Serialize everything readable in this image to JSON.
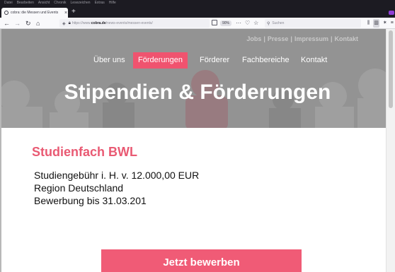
{
  "browser": {
    "menu": [
      "Datei",
      "Bearbeiten",
      "Ansicht",
      "Chronik",
      "Lesezeichen",
      "Extras",
      "Hilfe"
    ],
    "tab_title": "cobra: die Messen und Events",
    "tab_close": "×",
    "new_tab": "+",
    "url_domain": "cobra.de",
    "url_full_prefix": "https://www.",
    "url_full_suffix": "/news-events/messen-events/",
    "zoom": "90%",
    "search_placeholder": "Suchen",
    "icons": {
      "back": "back-arrow-icon",
      "forward": "forward-arrow-icon",
      "reload": "reload-icon",
      "home": "home-icon"
    }
  },
  "site": {
    "top_links": [
      "Jobs",
      "Presse",
      "Impressum",
      "Kontakt"
    ],
    "nav": [
      "Über uns",
      "Förderungen",
      "Förderer",
      "Fachbereiche",
      "Kontakt"
    ],
    "nav_active": "Förderungen",
    "hero_title": "Stipendien & Förderungen",
    "accent_color": "#f0536f"
  },
  "content": {
    "subject_title": "Studienfach BWL",
    "details": [
      "Studiengebühr i. H. v.  12.000,00 EUR",
      "Region Deutschland",
      "Bewerbung bis 31.03.201"
    ],
    "apply_label": "Jetzt bewerben"
  }
}
